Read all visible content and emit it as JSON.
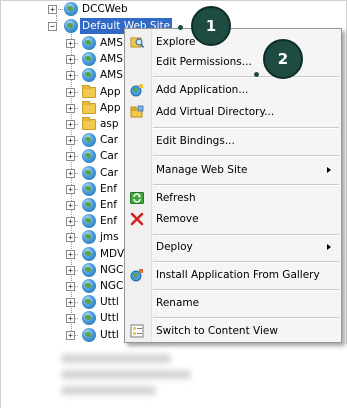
{
  "tree": {
    "top_nodes": [
      {
        "label": "DCCWeb",
        "icon": "globe-icon"
      },
      {
        "label": "Default Web Site",
        "icon": "globe-icon"
      }
    ],
    "children": [
      {
        "label": "AMS",
        "icon": "globe-icon"
      },
      {
        "label": "AMS",
        "icon": "globe-icon"
      },
      {
        "label": "AMS",
        "icon": "globe-icon"
      },
      {
        "label": "App",
        "icon": "folder-icon"
      },
      {
        "label": "App",
        "icon": "folder-icon"
      },
      {
        "label": "asp",
        "icon": "folder-icon"
      },
      {
        "label": "Car",
        "icon": "globe-icon"
      },
      {
        "label": "Car",
        "icon": "globe-icon"
      },
      {
        "label": "Car",
        "icon": "globe-icon"
      },
      {
        "label": "Enf",
        "icon": "globe-icon"
      },
      {
        "label": "Enf",
        "icon": "globe-icon"
      },
      {
        "label": "Enf",
        "icon": "globe-icon"
      },
      {
        "label": "jms",
        "icon": "globe-icon"
      },
      {
        "label": "MDV",
        "icon": "globe-icon"
      },
      {
        "label": "NGC",
        "icon": "globe-icon"
      },
      {
        "label": "NGC",
        "icon": "globe-icon"
      },
      {
        "label": "Uttl",
        "icon": "globe-icon"
      },
      {
        "label": "Uttl",
        "icon": "globe-icon"
      },
      {
        "label": "Uttl",
        "icon": "globe-icon"
      }
    ]
  },
  "menu": {
    "items": [
      {
        "label": "Explore",
        "icon": "explore-icon"
      },
      {
        "label": "Edit Permissions...",
        "icon": ""
      },
      {
        "label": "Add Application...",
        "icon": "add-application-icon"
      },
      {
        "label": "Add Virtual Directory...",
        "icon": "add-virtual-directory-icon"
      },
      {
        "label": "Edit Bindings...",
        "icon": ""
      },
      {
        "label": "Manage Web Site",
        "icon": "",
        "submenu": true
      },
      {
        "label": "Refresh",
        "icon": "refresh-icon"
      },
      {
        "label": "Remove",
        "icon": "remove-icon"
      },
      {
        "label": "Deploy",
        "icon": "",
        "submenu": true
      },
      {
        "label": "Install Application From Gallery",
        "icon": "gallery-icon"
      },
      {
        "label": "Rename",
        "icon": ""
      },
      {
        "label": "Switch to Content View",
        "icon": "content-view-icon"
      }
    ]
  },
  "callouts": {
    "one": "1",
    "two": "2"
  },
  "colors": {
    "selection": "#3169c6",
    "callout": "#1e4c43",
    "menu_bg": "#f5f5f5"
  }
}
